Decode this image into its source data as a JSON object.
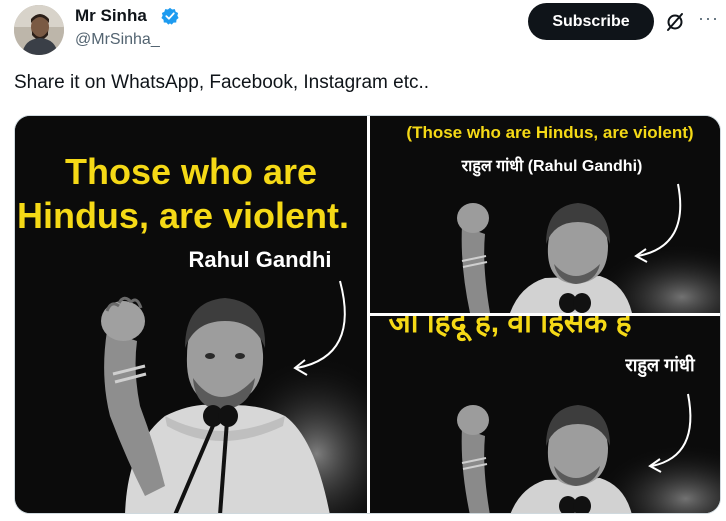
{
  "user": {
    "name": "Mr Sinha",
    "handle": "@MrSinha_"
  },
  "header": {
    "subscribe_label": "Subscribe",
    "more_label": "···",
    "icons": [
      "verified-badge-icon",
      "grok-icon",
      "more-icon"
    ]
  },
  "post": {
    "text": "Share it on WhatsApp, Facebook, Instagram etc.."
  },
  "media": {
    "panel1": {
      "quote_line1": "Those who are",
      "quote_line2": "Hindus, are violent.",
      "attribution": "Rahul Gandhi"
    },
    "panel2": {
      "quote": "(Those who are Hindus, are violent)",
      "attribution": "राहुल गांधी (Rahul Gandhi)"
    },
    "panel3": {
      "quote": "जो हिंदू है, वो हिंसक है",
      "attribution": "राहुल गांधी"
    }
  },
  "colors": {
    "quote_yellow": "#f5d916",
    "verified_blue": "#1d9bf0",
    "subscribe_bg": "#0f1419",
    "handle_gray": "#536471"
  }
}
